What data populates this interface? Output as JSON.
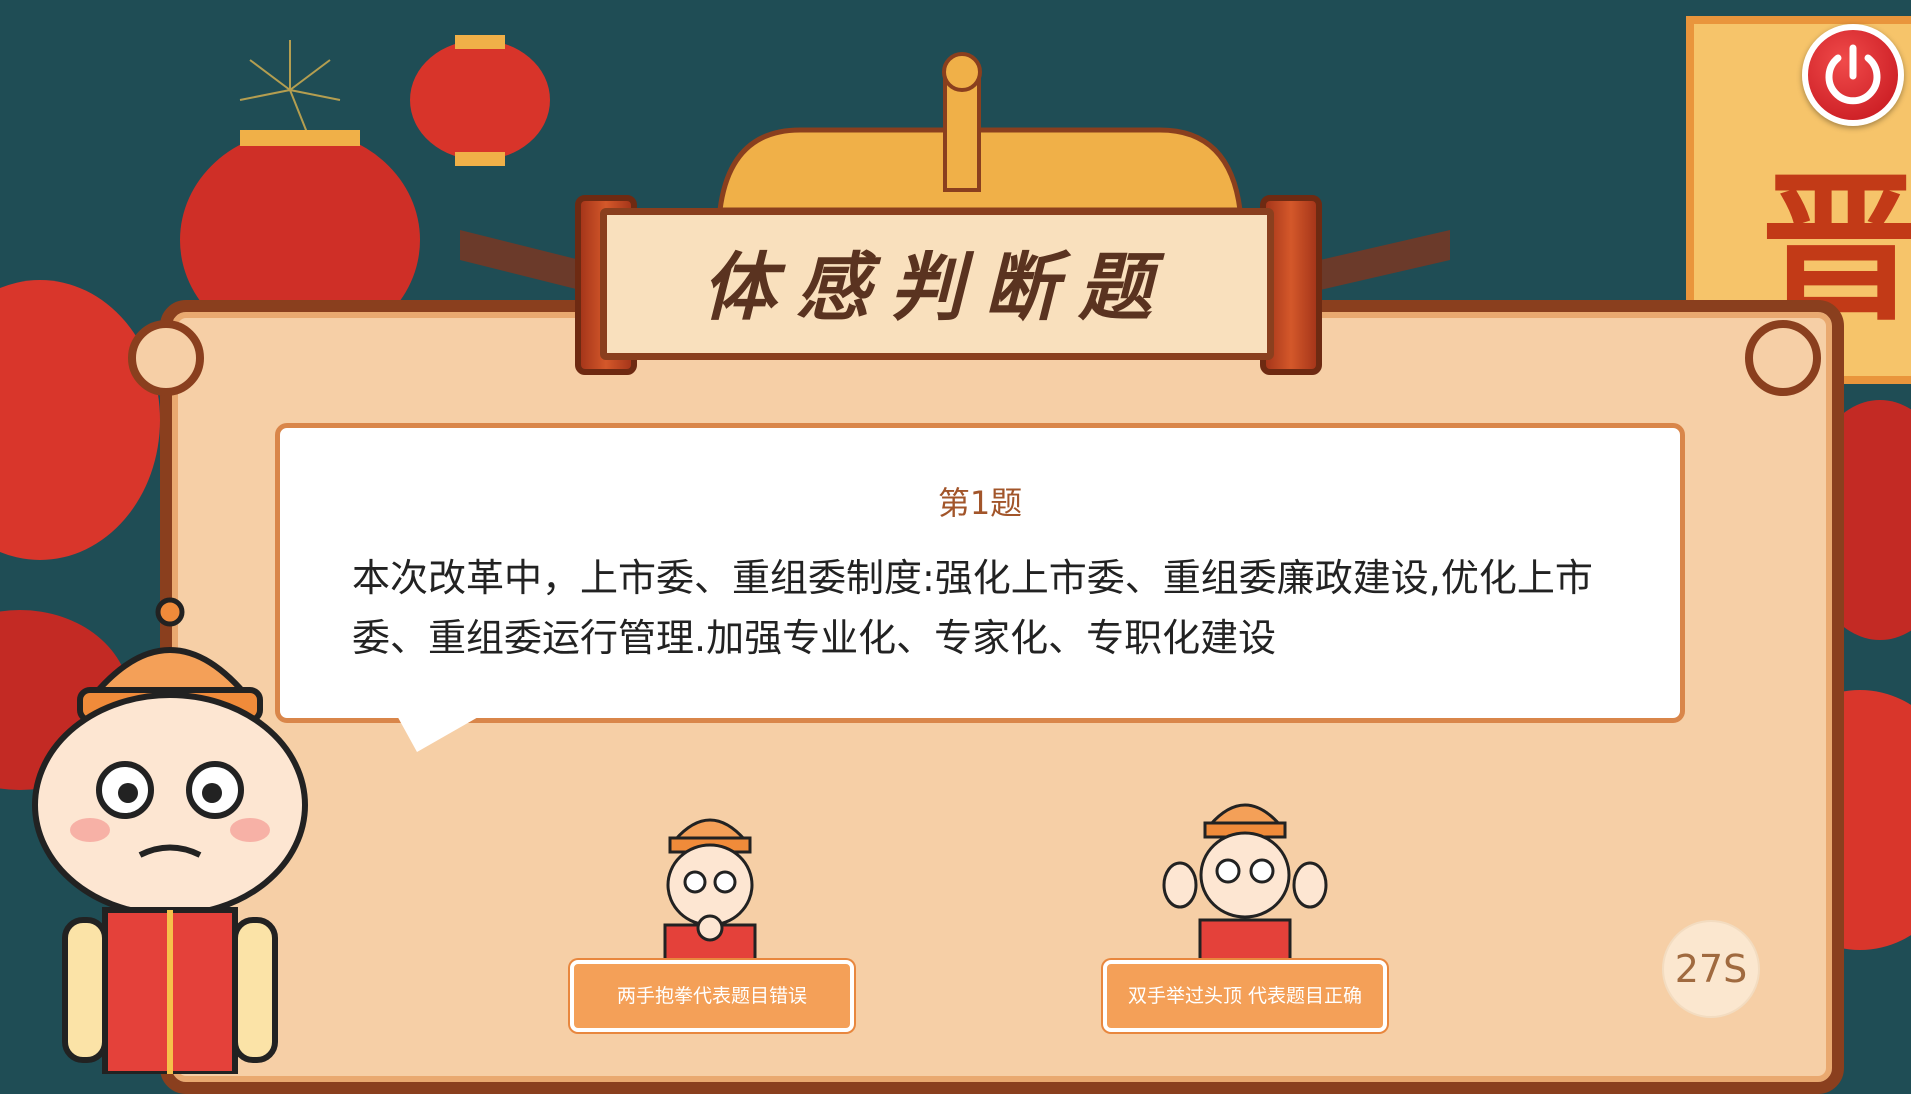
{
  "banner": {
    "title": "体感判断题"
  },
  "question": {
    "number_label": "第1题",
    "text": "本次改革中，上市委、重组委制度:强化上市委、重组委廉政建设,优化上市委、重组委运行管理.加强专业化、专家化、专职化建设"
  },
  "choices": [
    {
      "label": "两手抱拳代表题目错误"
    },
    {
      "label": "双手举过头顶 代表题目正确"
    }
  ],
  "timer": {
    "text": "27S"
  },
  "side_banner": {
    "char": "晋"
  },
  "colors": {
    "frame": "#8a3f1e",
    "panel": "#f6cfa6",
    "button": "#f4a058",
    "power": "#c3131b",
    "background": "#1f4d55"
  },
  "icons": [
    "power-icon",
    "lantern-icon",
    "mascot-icon"
  ]
}
